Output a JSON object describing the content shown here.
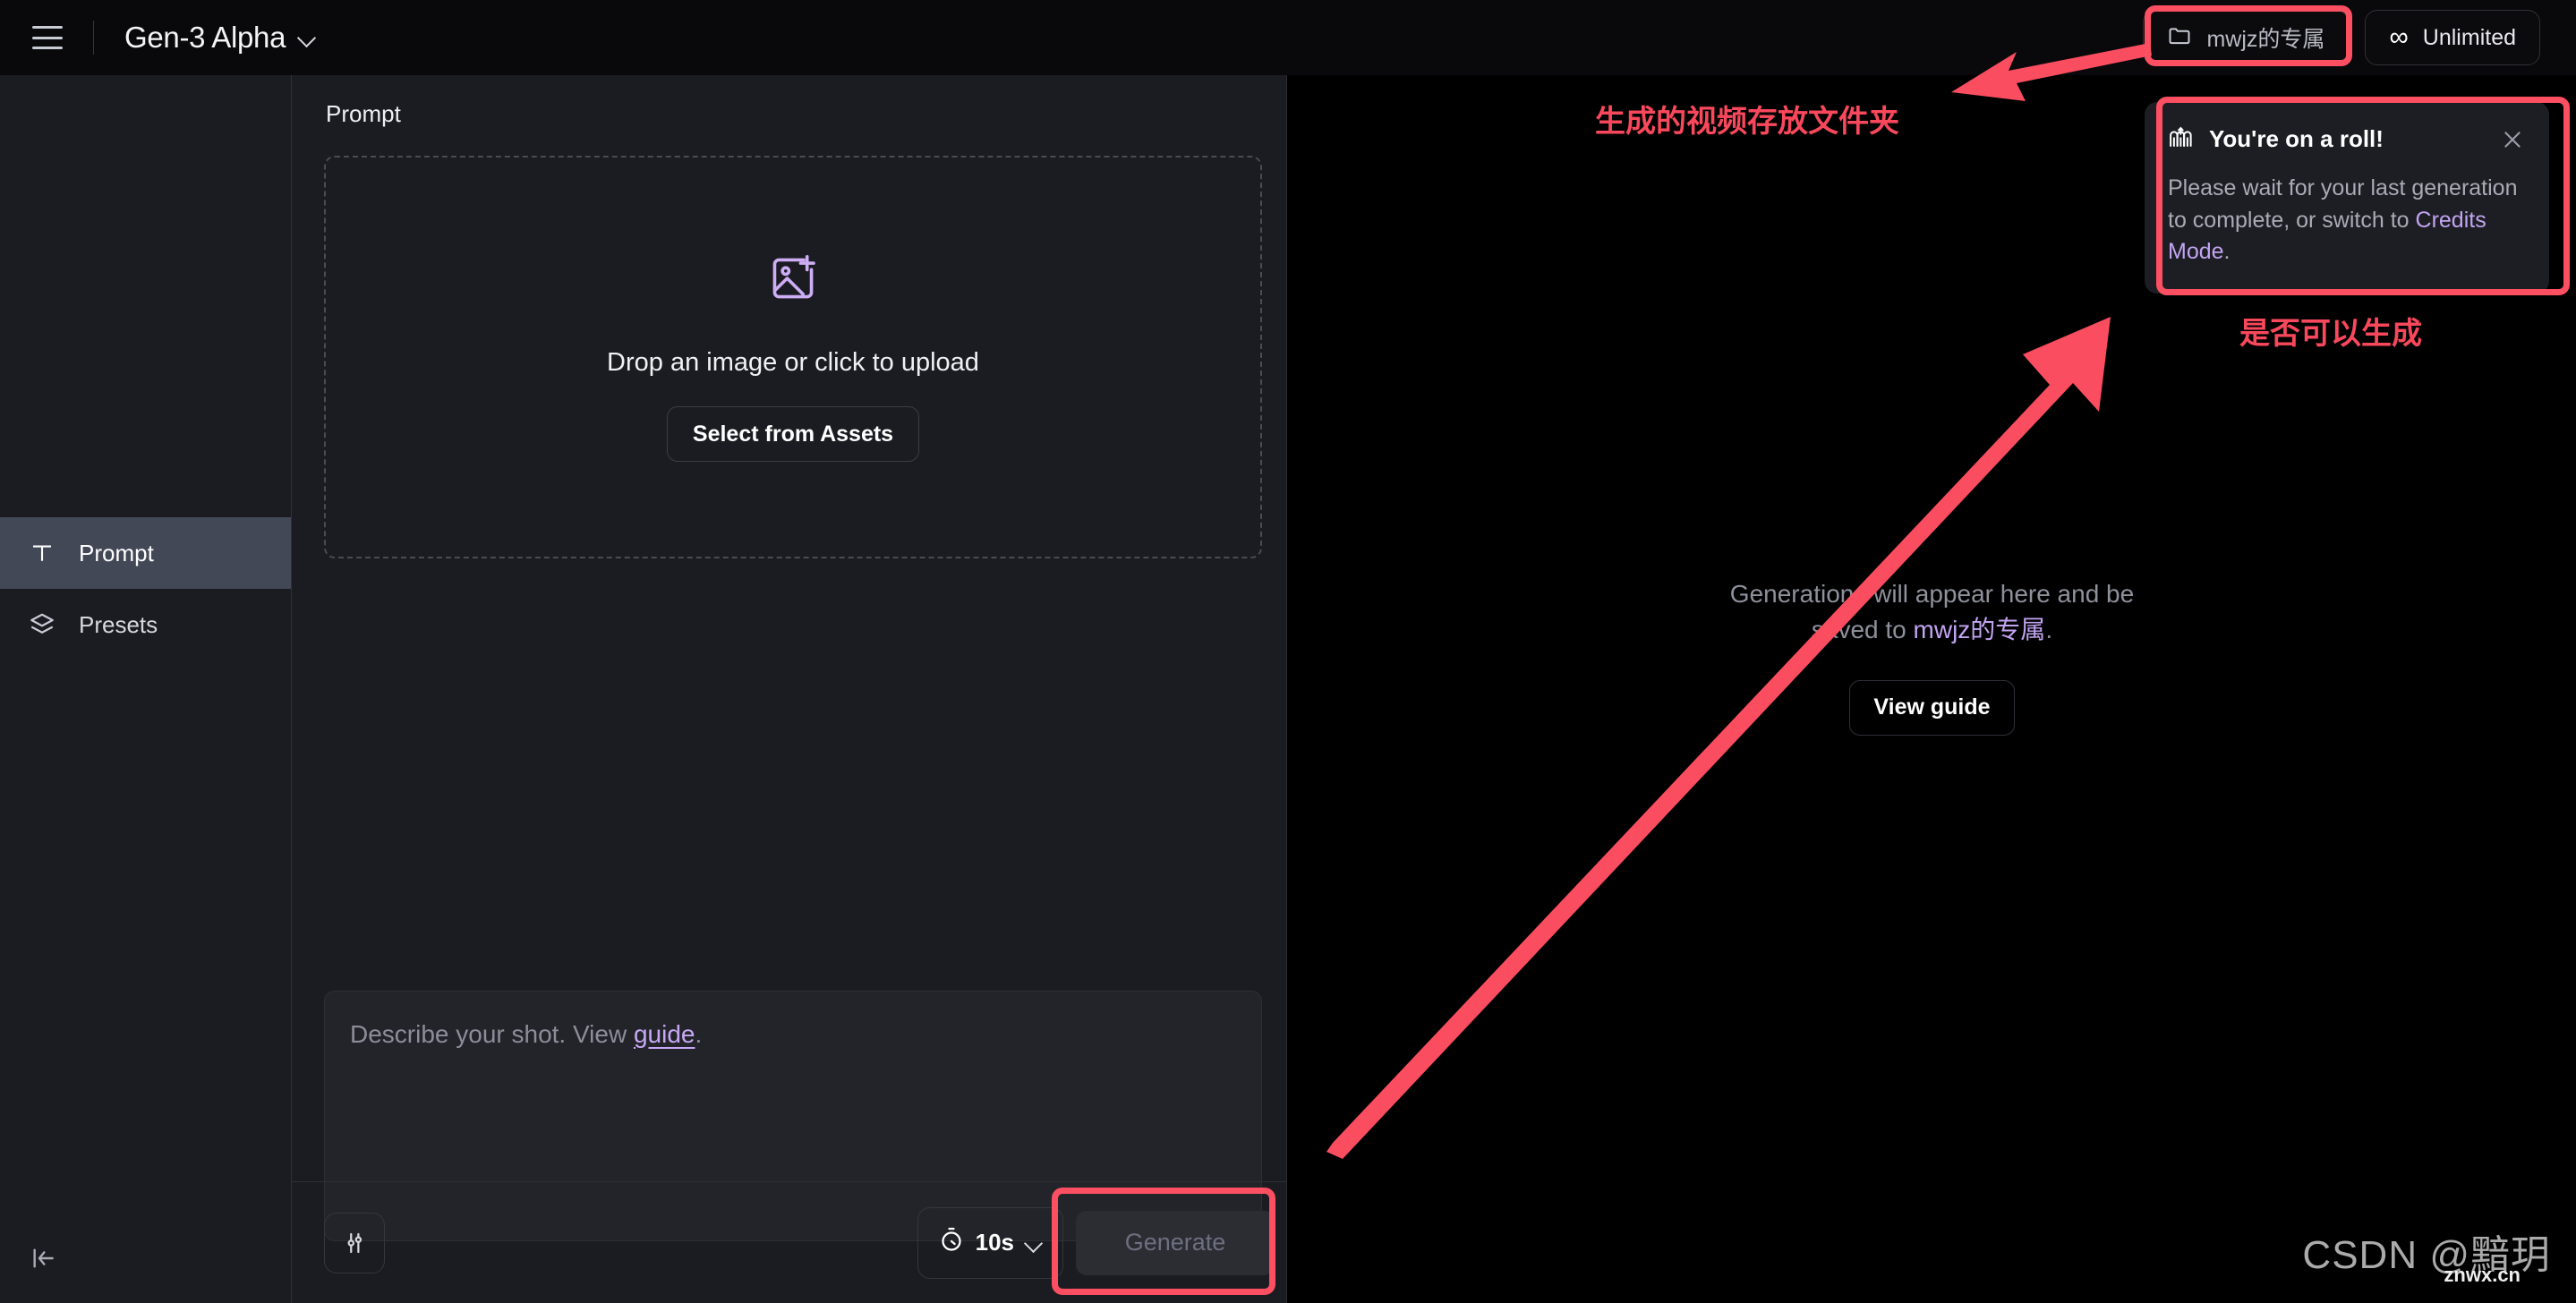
{
  "topbar": {
    "menu_icon": "hamburger-icon",
    "model_name": "Gen-3 Alpha",
    "model_chevron_icon": "chevron-down-icon",
    "folder_icon": "folder-icon",
    "folder_name": "mwjz的专属",
    "plan_icon": "infinity-icon",
    "plan_label": "Unlimited"
  },
  "sidebar": {
    "items": [
      {
        "label": "Prompt",
        "icon": "text-t-icon",
        "active": true
      },
      {
        "label": "Presets",
        "icon": "layers-icon",
        "active": false
      }
    ],
    "collapse_icon": "collapse-panel-icon"
  },
  "panel": {
    "title": "Prompt",
    "dropzone": {
      "icon": "image-plus-icon",
      "text": "Drop an image or click to upload",
      "button_label": "Select from Assets"
    },
    "prompt_input": {
      "value": "",
      "placeholder_prefix": "Describe your shot. View ",
      "placeholder_link": "guide",
      "placeholder_suffix": "."
    },
    "footer": {
      "settings_icon": "sliders-settings-icon",
      "duration_icon": "stopwatch-icon",
      "duration_value": "10s",
      "duration_chevron_icon": "chevron-down-icon",
      "generate_label": "Generate",
      "generate_disabled": true
    }
  },
  "canvas": {
    "empty_prefix": "Generations will appear here and be saved to ",
    "empty_folder": "mwjz的专属",
    "empty_suffix": ".",
    "view_guide_label": "View guide"
  },
  "toast": {
    "icon": "roller-coaster-icon",
    "title": "You're on a roll!",
    "close_icon": "close-x-icon",
    "body_prefix": "Please wait for your last generation to complete, or switch to ",
    "body_link": "Credits Mode",
    "body_suffix": "."
  },
  "annotations": {
    "folder_note": "生成的视频存放文件夹",
    "generate_note": "是否可以生成",
    "accent_color": "#fc4f62"
  },
  "watermark": {
    "text": "CSDN @黯玥",
    "sub": "znwx.cn"
  }
}
